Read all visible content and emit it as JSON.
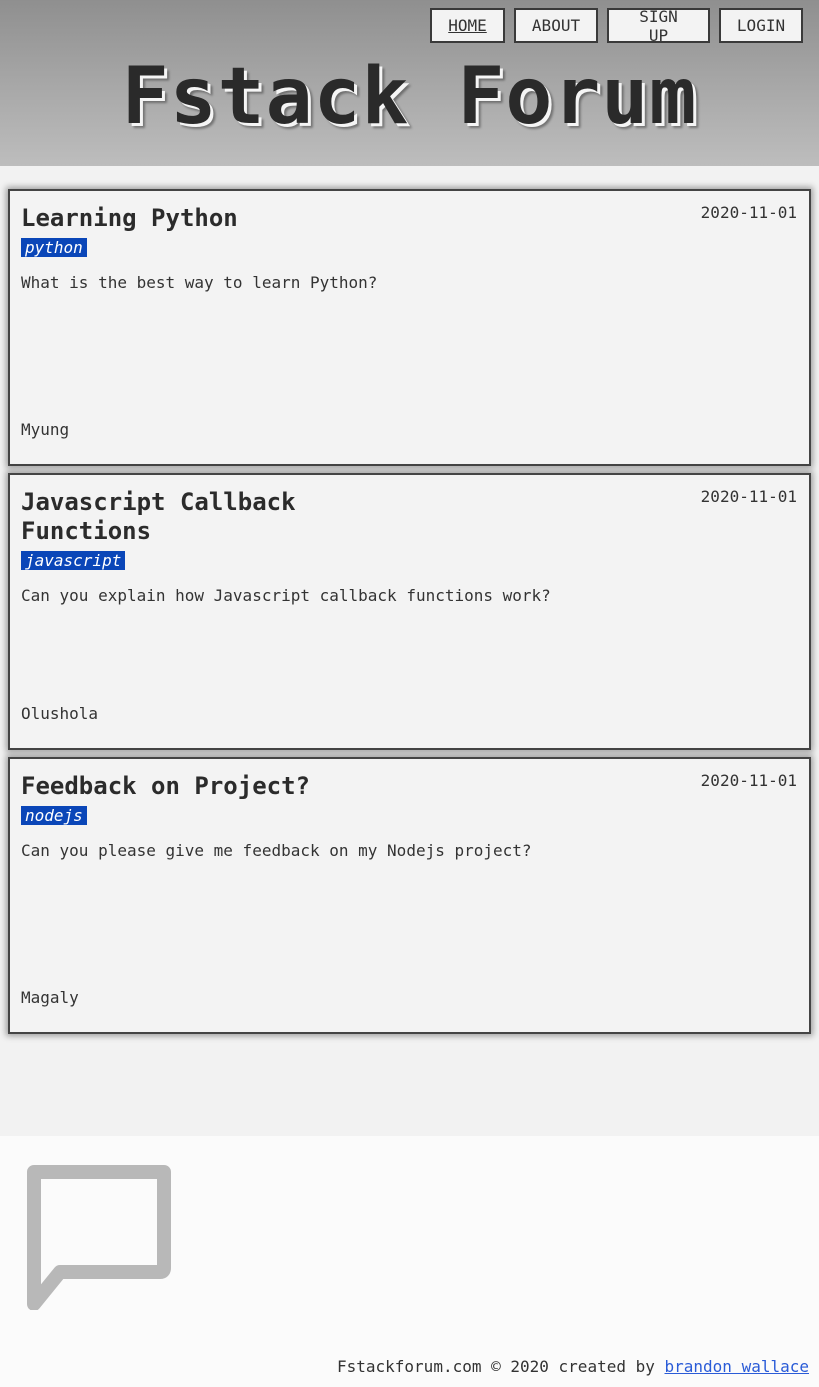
{
  "nav": {
    "items": [
      {
        "label": "HOME"
      },
      {
        "label": "ABOUT"
      },
      {
        "label": "SIGN UP"
      },
      {
        "label": "LOGIN"
      }
    ]
  },
  "site": {
    "title": "Fstack Forum"
  },
  "posts": [
    {
      "title": "Learning Python",
      "date": "2020-11-01",
      "tag": "python",
      "body": "What is the best way to learn Python?",
      "author": "Myung"
    },
    {
      "title": "Javascript Callback Functions",
      "date": "2020-11-01",
      "tag": "javascript",
      "body": "Can you explain how Javascript callback functions work?",
      "author": "Olushola"
    },
    {
      "title": "Feedback on Project?",
      "date": "2020-11-01",
      "tag": "nodejs",
      "body": "Can you please give me feedback on my Nodejs project?",
      "author": "Magaly"
    }
  ],
  "footer": {
    "icon": "chat-bubble-icon",
    "text_prefix": "Fstackforum.com © 2020 created by ",
    "link_text": "brandon wallace"
  },
  "colors": {
    "tag_bg": "#0a46b8",
    "link": "#2a5bd7"
  }
}
